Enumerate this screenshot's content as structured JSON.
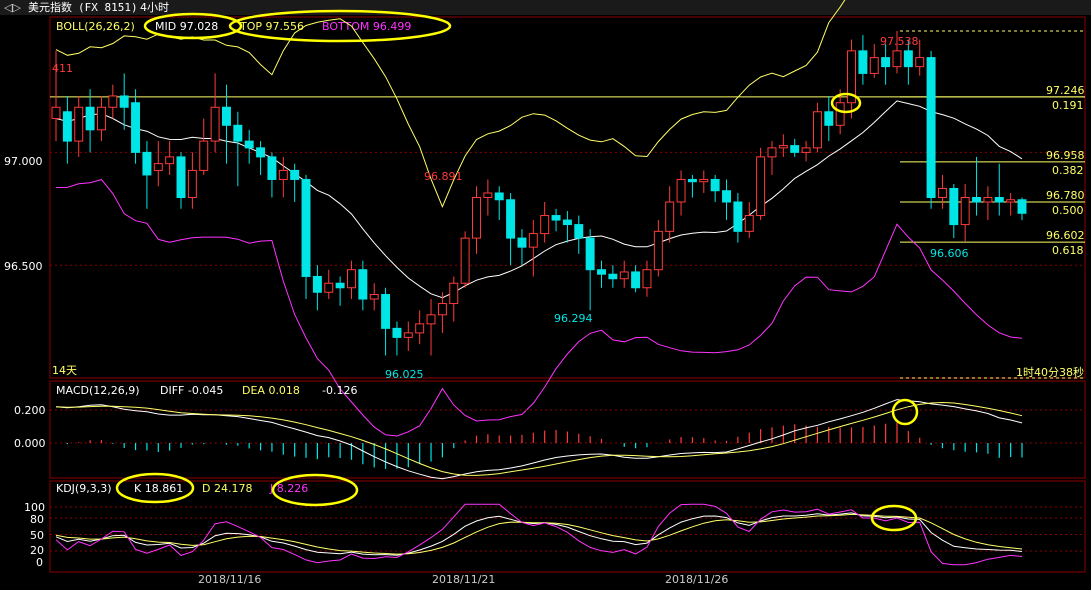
{
  "toolbar": {
    "title": "美元指数",
    "code": "(FX 8151)",
    "period": "4小时"
  },
  "colors": {
    "up": "#ff3b3b",
    "down": "#00e5e5",
    "mid": "#ffffff",
    "top": "#ffff66",
    "bottom": "#ff33ff",
    "macd_diff": "#ffffff",
    "macd_dea": "#ffff66",
    "kdj_k": "#ffffff",
    "kdj_d": "#ffff66",
    "kdj_j": "#ff33ff",
    "highlight": "#ffff00"
  },
  "boll": {
    "label": "BOLL(26,26,2)",
    "mid_label": "MID 97.028",
    "top_label": "TOP 97.556",
    "bottom_label": "BOTTOM 96.499",
    "days_label": "14天",
    "countdown": "1时40分38秒",
    "corner_label": "411"
  },
  "macd": {
    "label": "MACD(12,26,9)",
    "diff_label": "DIFF -0.045",
    "dea_label": "DEA 0.018",
    "macd_value": "-0.126",
    "ticks": [
      "0.200",
      "0.000"
    ]
  },
  "kdj": {
    "label": "KDJ(9,3,3)",
    "k_label": "K 18.861",
    "d_label": "D 24.178",
    "j_label": "J 8.226",
    "ticks": [
      "100",
      "80",
      "50",
      "20",
      "0"
    ]
  },
  "price_axis": [
    "97.000",
    "96.500"
  ],
  "annotations": {
    "high": "97.538",
    "peak1": "96.891",
    "low1": "96.025",
    "low2": "96.294",
    "low3": "96.606"
  },
  "fib": [
    {
      "price": "97.246",
      "ratio": "0.191"
    },
    {
      "price": "96.958",
      "ratio": "0.382"
    },
    {
      "price": "96.780",
      "ratio": "0.500"
    },
    {
      "price": "96.602",
      "ratio": "0.618"
    }
  ],
  "chart_data": {
    "type": "candlestick",
    "x_ticks": [
      "2018/11/16",
      "2018/11/21",
      "2018/11/26"
    ],
    "candles": [
      [
        97.15,
        97.2,
        97.45,
        97.05
      ],
      [
        97.18,
        97.05,
        97.25,
        96.95
      ],
      [
        97.05,
        97.2,
        97.25,
        96.98
      ],
      [
        97.2,
        97.1,
        97.28,
        97.0
      ],
      [
        97.1,
        97.2,
        97.25,
        97.05
      ],
      [
        97.2,
        97.25,
        97.3,
        97.15
      ],
      [
        97.25,
        97.2,
        97.35,
        97.1
      ],
      [
        97.22,
        97.0,
        97.28,
        96.95
      ],
      [
        97.0,
        96.9,
        97.05,
        96.75
      ],
      [
        96.92,
        96.95,
        97.05,
        96.85
      ],
      [
        96.95,
        96.98,
        97.05,
        96.9
      ],
      [
        96.98,
        96.8,
        97.0,
        96.75
      ],
      [
        96.8,
        96.92,
        97.0,
        96.75
      ],
      [
        96.92,
        97.05,
        97.15,
        96.9
      ],
      [
        97.05,
        97.2,
        97.35,
        97.0
      ],
      [
        97.2,
        97.12,
        97.3,
        96.95
      ],
      [
        97.12,
        97.05,
        97.18,
        96.85
      ],
      [
        97.05,
        97.02,
        97.1,
        96.95
      ],
      [
        97.02,
        96.98,
        97.05,
        96.9
      ],
      [
        96.98,
        96.88,
        97.0,
        96.8
      ],
      [
        96.88,
        96.92,
        96.98,
        96.8
      ],
      [
        96.92,
        96.88,
        96.95,
        96.78
      ],
      [
        96.88,
        96.45,
        96.9,
        96.35
      ],
      [
        96.45,
        96.38,
        96.5,
        96.3
      ],
      [
        96.38,
        96.42,
        96.48,
        96.35
      ],
      [
        96.42,
        96.4,
        96.45,
        96.32
      ],
      [
        96.4,
        96.48,
        96.52,
        96.35
      ],
      [
        96.48,
        96.35,
        96.52,
        96.3
      ],
      [
        96.35,
        96.37,
        96.42,
        96.3
      ],
      [
        96.37,
        96.22,
        96.4,
        96.1
      ],
      [
        96.22,
        96.18,
        96.25,
        96.1
      ],
      [
        96.18,
        96.2,
        96.25,
        96.12
      ],
      [
        96.2,
        96.24,
        96.3,
        96.15
      ],
      [
        96.24,
        96.28,
        96.35,
        96.1
      ],
      [
        96.28,
        96.33,
        96.38,
        96.2
      ],
      [
        96.33,
        96.42,
        96.45,
        96.25
      ],
      [
        96.42,
        96.62,
        96.65,
        96.4
      ],
      [
        96.62,
        96.8,
        96.85,
        96.55
      ],
      [
        96.8,
        96.82,
        96.88,
        96.72
      ],
      [
        96.82,
        96.79,
        96.85,
        96.7
      ],
      [
        96.79,
        96.62,
        96.82,
        96.5
      ],
      [
        96.62,
        96.58,
        96.66,
        96.5
      ],
      [
        96.58,
        96.64,
        96.7,
        96.45
      ],
      [
        96.64,
        96.72,
        96.78,
        96.6
      ],
      [
        96.72,
        96.7,
        96.75,
        96.65
      ],
      [
        96.7,
        96.68,
        96.74,
        96.6
      ],
      [
        96.68,
        96.62,
        96.72,
        96.55
      ],
      [
        96.62,
        96.48,
        96.66,
        96.3
      ],
      [
        96.48,
        96.46,
        96.52,
        96.4
      ],
      [
        96.46,
        96.44,
        96.5,
        96.4
      ],
      [
        96.44,
        96.47,
        96.52,
        96.4
      ],
      [
        96.47,
        96.4,
        96.5,
        96.38
      ],
      [
        96.4,
        96.48,
        96.52,
        96.36
      ],
      [
        96.48,
        96.65,
        96.7,
        96.45
      ],
      [
        96.65,
        96.78,
        96.85,
        96.6
      ],
      [
        96.78,
        96.88,
        96.92,
        96.72
      ],
      [
        96.88,
        96.87,
        96.9,
        96.8
      ],
      [
        96.87,
        96.88,
        96.92,
        96.82
      ],
      [
        96.88,
        96.83,
        96.9,
        96.78
      ],
      [
        96.83,
        96.78,
        96.88,
        96.7
      ],
      [
        96.78,
        96.65,
        96.82,
        96.6
      ],
      [
        96.65,
        96.72,
        96.78,
        96.62
      ],
      [
        96.72,
        96.98,
        97.02,
        96.7
      ],
      [
        96.98,
        97.02,
        97.05,
        96.9
      ],
      [
        97.02,
        97.03,
        97.08,
        96.98
      ],
      [
        97.03,
        97.0,
        97.06,
        96.98
      ],
      [
        97.0,
        97.02,
        97.05,
        96.96
      ],
      [
        97.02,
        97.18,
        97.22,
        97.0
      ],
      [
        97.18,
        97.12,
        97.25,
        97.05
      ],
      [
        97.12,
        97.22,
        97.28,
        97.08
      ],
      [
        97.22,
        97.45,
        97.5,
        97.15
      ],
      [
        97.45,
        97.35,
        97.52,
        97.3
      ],
      [
        97.35,
        97.42,
        97.48,
        97.33
      ],
      [
        97.42,
        97.38,
        97.48,
        97.3
      ],
      [
        97.38,
        97.45,
        97.538,
        97.35
      ],
      [
        97.45,
        97.38,
        97.5,
        97.3
      ],
      [
        97.38,
        97.42,
        97.5,
        97.34
      ],
      [
        97.42,
        96.8,
        97.45,
        96.75
      ],
      [
        96.8,
        96.84,
        96.9,
        96.75
      ],
      [
        96.84,
        96.68,
        96.86,
        96.62
      ],
      [
        96.68,
        96.8,
        96.86,
        96.606
      ],
      [
        96.8,
        96.78,
        96.98,
        96.72
      ],
      [
        96.78,
        96.8,
        96.85,
        96.7
      ],
      [
        96.8,
        96.78,
        96.95,
        96.72
      ],
      [
        96.78,
        96.79,
        96.82,
        96.72
      ],
      [
        96.79,
        96.73,
        96.8,
        96.7
      ]
    ],
    "price_range": [
      96.0,
      97.6
    ]
  }
}
